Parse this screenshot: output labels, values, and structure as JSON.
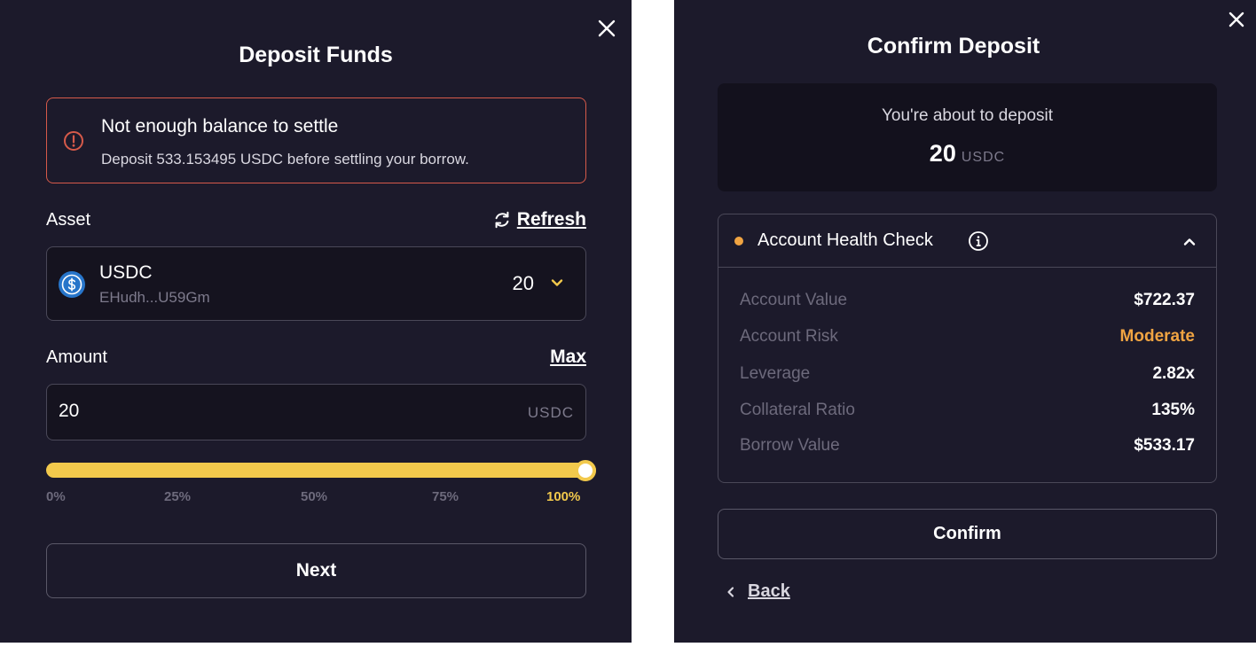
{
  "deposit_modal": {
    "title": "Deposit Funds",
    "warning": {
      "title": "Not enough balance to settle",
      "text": "Deposit 533.153495 USDC before settling your borrow."
    },
    "asset_label": "Asset",
    "refresh_label": "Refresh",
    "asset": {
      "symbol": "USDC",
      "address": "EHudh...U59Gm",
      "balance": "20"
    },
    "amount_label": "Amount",
    "max_label": "Max",
    "amount_value": "20",
    "amount_unit": "USDC",
    "slider": {
      "value_percent": 100,
      "ticks": [
        "0%",
        "25%",
        "50%",
        "75%",
        "100%"
      ]
    },
    "next_label": "Next"
  },
  "confirm_modal": {
    "title": "Confirm Deposit",
    "summary_label": "You're about to deposit",
    "summary_amount": "20",
    "summary_unit": "USDC",
    "health": {
      "title": "Account Health Check",
      "status_color": "#f0a442",
      "rows": [
        {
          "label": "Account Value",
          "value": "$722.37"
        },
        {
          "label": "Account Risk",
          "value": "Moderate"
        },
        {
          "label": "Leverage",
          "value": "2.82x"
        },
        {
          "label": "Collateral Ratio",
          "value": "135%"
        },
        {
          "label": "Borrow Value",
          "value": "$533.17"
        }
      ]
    },
    "confirm_label": "Confirm",
    "back_label": "Back"
  },
  "colors": {
    "panel_bg": "#1c1a2b",
    "accent_yellow": "#f2c94c",
    "warning_red": "#d65a4a",
    "moderate_orange": "#f0a442"
  },
  "icons": [
    "close-icon",
    "alert-circle-icon",
    "refresh-icon",
    "usdc-logo-icon",
    "chevron-down-icon",
    "info-icon",
    "chevron-up-icon",
    "chevron-left-icon"
  ]
}
